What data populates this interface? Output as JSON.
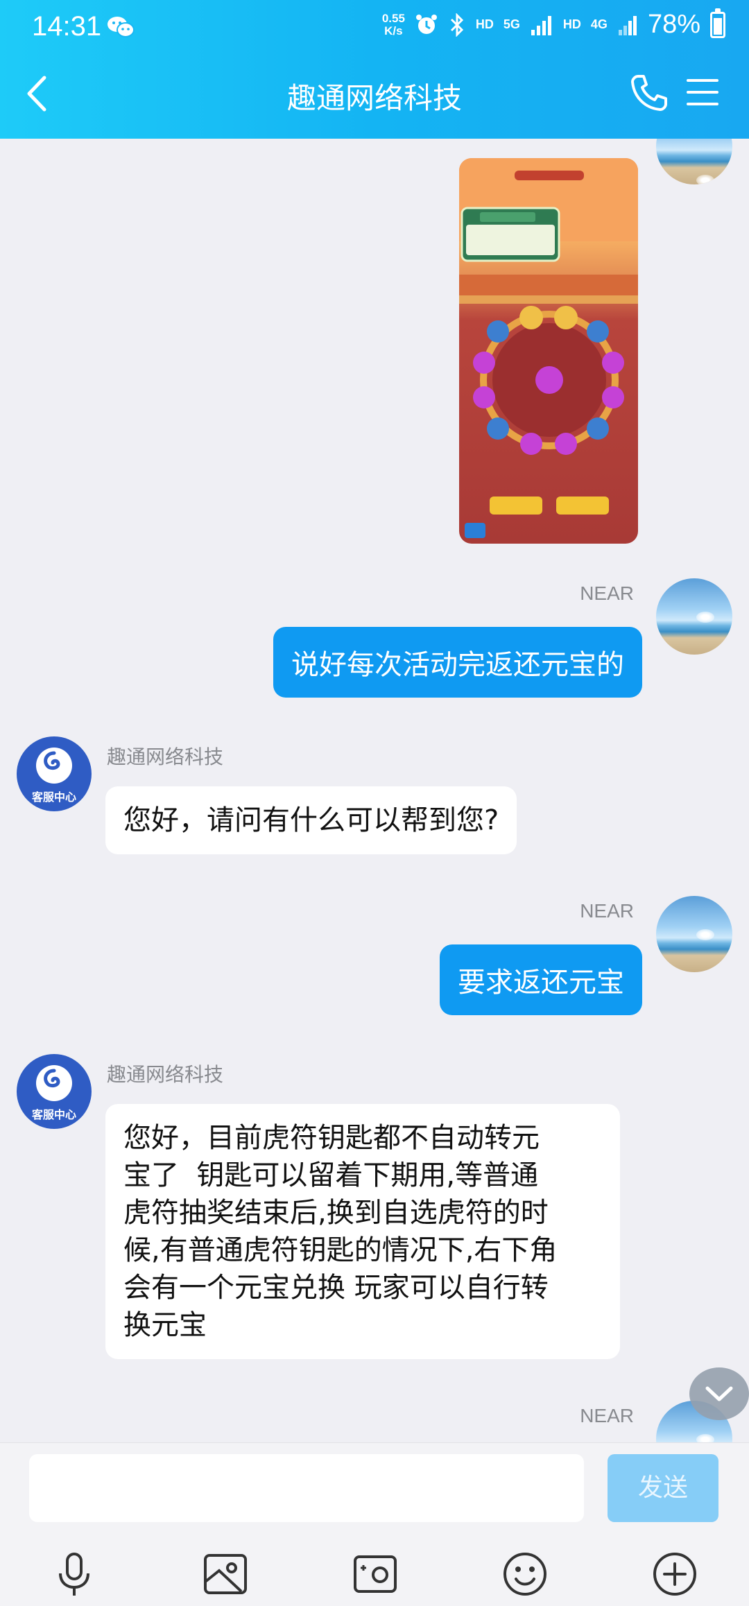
{
  "status_bar": {
    "time": "14:31",
    "speed_value": "0.55",
    "speed_unit": "K/s",
    "hd1": "HD",
    "net5g": "5G",
    "hd2": "HD",
    "net4g": "4G",
    "battery": "78%",
    "icons": [
      "wechat-icon",
      "alarm-icon",
      "bluetooth-icon",
      "signal-icon",
      "battery-icon"
    ]
  },
  "header": {
    "title": "趣通网络科技",
    "icons": [
      "back-arrow-icon",
      "phone-icon",
      "menu-icon"
    ]
  },
  "messages": [
    {
      "from": "me",
      "type": "image",
      "content_icon": "game-screenshot"
    },
    {
      "from": "me",
      "name": "NEAR",
      "text": "说好每次活动完返还元宝的"
    },
    {
      "from": "cs",
      "name": "趣通网络科技",
      "avatar_label": "客服中心",
      "text": "您好，请问有什么可以帮到您?"
    },
    {
      "from": "me",
      "name": "NEAR",
      "text": "要求返还元宝"
    },
    {
      "from": "cs",
      "name": "趣通网络科技",
      "avatar_label": "客服中心",
      "lines": [
        "您好，目前虎符钥匙都不自动转元",
        "宝了  钥匙可以留着下期用,等普通",
        "虎符抽奖结束后,换到自选虎符的时",
        "候,有普通虎符钥匙的情况下,右下角",
        "会有一个元宝兑换 玩家可以自行转",
        "换元宝"
      ]
    },
    {
      "from": "me",
      "name": "NEAR"
    }
  ],
  "input": {
    "placeholder": "",
    "send_label": "发送"
  },
  "toolbar": [
    "microphone-icon",
    "image-icon",
    "camera-icon",
    "emoji-icon",
    "plus-icon"
  ],
  "colors": {
    "header": "#14b4f3",
    "bubble_me": "#0f9af2",
    "send_disabled": "#86cdf7"
  }
}
